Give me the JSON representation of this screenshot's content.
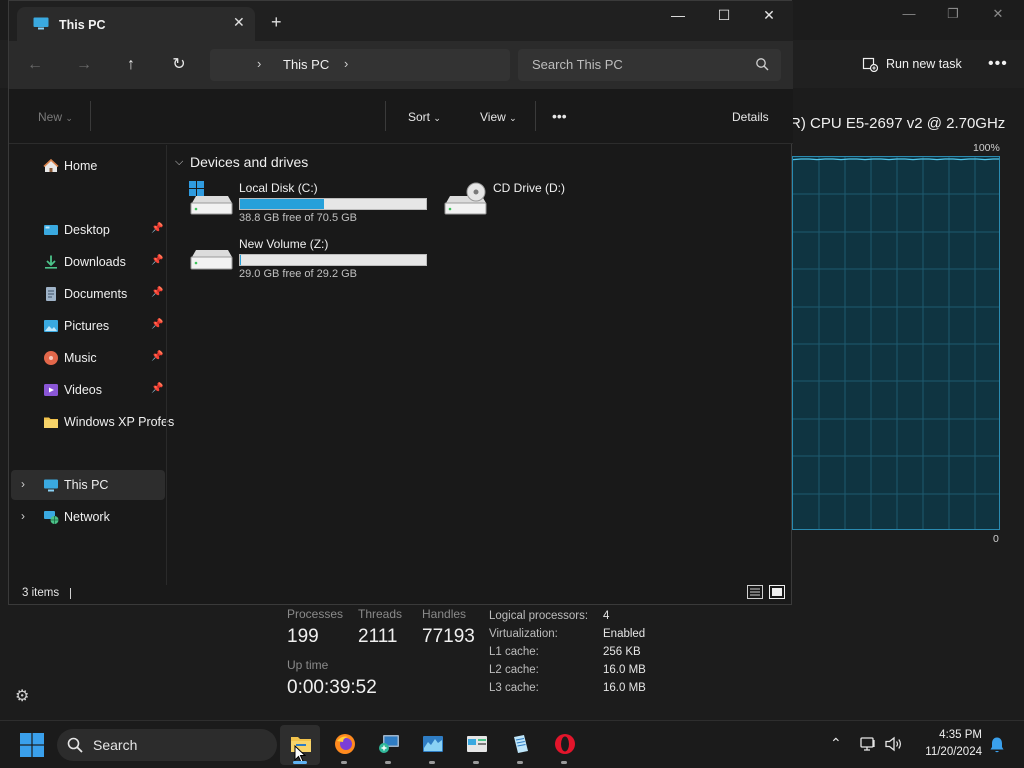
{
  "task_manager": {
    "run_new_task": "Run new task",
    "more": "•••",
    "cpu_name": "R) CPU E5-2697 v2 @ 2.70GHz",
    "graph_max_label": "100%",
    "graph_min_label": "0",
    "utilization_percent": 1,
    "stats": {
      "processes_label": "Processes",
      "processes_value": "199",
      "threads_label": "Threads",
      "threads_value": "2111",
      "handles_label": "Handles",
      "handles_value": "77193",
      "uptime_label": "Up time",
      "uptime_value": "0:00:39:52"
    },
    "details": [
      {
        "label": "Logical processors:",
        "value": "4"
      },
      {
        "label": "Virtualization:",
        "value": "Enabled"
      },
      {
        "label": "L1 cache:",
        "value": "256 KB"
      },
      {
        "label": "L2 cache:",
        "value": "16.0 MB"
      },
      {
        "label": "L3 cache:",
        "value": "16.0 MB"
      }
    ],
    "window_controls": {
      "minimize": "—",
      "maximize": "❐",
      "close": "✕"
    }
  },
  "explorer": {
    "tab_title": "This PC",
    "tab_close": "✕",
    "new_tab": "+",
    "window_controls": {
      "minimize": "—",
      "maximize": "☐",
      "close": "✕"
    },
    "nav": {
      "back": "←",
      "forward": "→",
      "up": "↑",
      "refresh": "↻"
    },
    "address": {
      "chevron": "›",
      "path": "This PC"
    },
    "search_placeholder": "Search This PC",
    "commands": {
      "new": "New",
      "sort": "Sort",
      "view": "View",
      "more": "•••",
      "details": "Details"
    },
    "sidebar": {
      "home": "Home",
      "quick_access": [
        {
          "label": "Desktop",
          "icon": "desktop-icon",
          "pinned": true
        },
        {
          "label": "Downloads",
          "icon": "downloads-icon",
          "pinned": true
        },
        {
          "label": "Documents",
          "icon": "documents-icon",
          "pinned": true
        },
        {
          "label": "Pictures",
          "icon": "pictures-icon",
          "pinned": true
        },
        {
          "label": "Music",
          "icon": "music-icon",
          "pinned": true
        },
        {
          "label": "Videos",
          "icon": "videos-icon",
          "pinned": true
        },
        {
          "label": "Windows XP Profes",
          "icon": "folder-icon",
          "pinned": false
        }
      ],
      "this_pc": "This PC",
      "network": "Network"
    },
    "group_title": "Devices and drives",
    "drives": [
      {
        "name": "Local Disk (C:)",
        "free_text": "38.8 GB free of 70.5 GB",
        "used_fraction": 0.45,
        "icon": "windows-drive-icon"
      },
      {
        "name": "CD Drive (D:)",
        "icon": "cd-drive-icon"
      },
      {
        "name": "New Volume (Z:)",
        "free_text": "29.0 GB free of 29.2 GB",
        "used_fraction": 0.007,
        "icon": "hard-drive-icon"
      }
    ],
    "status": {
      "items": "3 items"
    }
  },
  "taskbar": {
    "search": "Search",
    "apps": [
      "file-explorer-icon",
      "firefox-icon",
      "remote-desktop-icon",
      "task-manager-icon",
      "virtualbox-icon",
      "notepad-icon",
      "opera-icon"
    ],
    "time": "4:35 PM",
    "date": "11/20/2024"
  },
  "colors": {
    "accent": "#26a0da",
    "graph_bg": "#0f3441",
    "graph_border": "#2a8ab0"
  }
}
